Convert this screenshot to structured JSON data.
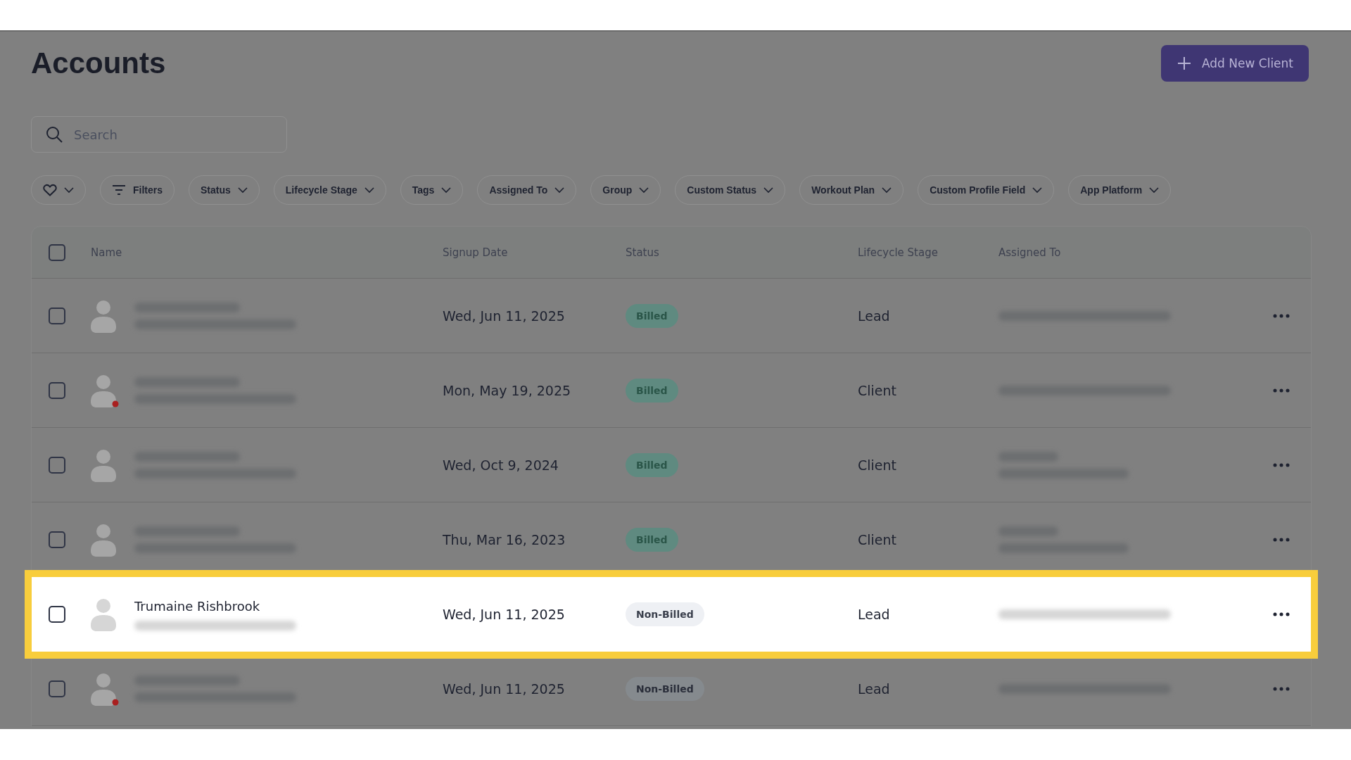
{
  "page": {
    "title": "Accounts"
  },
  "add_button": {
    "label": "Add New Client"
  },
  "search": {
    "placeholder": "Search"
  },
  "filters": [
    {
      "kind": "favorite"
    },
    {
      "kind": "filters",
      "label": "Filters"
    },
    {
      "kind": "dropdown",
      "label": "Status"
    },
    {
      "kind": "dropdown",
      "label": "Lifecycle Stage"
    },
    {
      "kind": "dropdown",
      "label": "Tags"
    },
    {
      "kind": "dropdown",
      "label": "Assigned To"
    },
    {
      "kind": "dropdown",
      "label": "Group"
    },
    {
      "kind": "dropdown",
      "label": "Custom Status"
    },
    {
      "kind": "dropdown",
      "label": "Workout Plan"
    },
    {
      "kind": "dropdown",
      "label": "Custom Profile Field"
    },
    {
      "kind": "dropdown",
      "label": "App Platform"
    }
  ],
  "table": {
    "columns": [
      "Name",
      "Signup Date",
      "Status",
      "Lifecycle Stage",
      "Assigned To"
    ],
    "all_checked": false,
    "rows": [
      {
        "checked": false,
        "alert_dot": false,
        "highlighted": false,
        "signup_date": "Wed, Jun 11, 2025",
        "status": "Billed",
        "billed": true,
        "lifecycle_stage": "Lead",
        "assigned_to": {
          "kind": "single"
        }
      },
      {
        "checked": false,
        "alert_dot": true,
        "highlighted": false,
        "signup_date": "Mon, May 19, 2025",
        "status": "Billed",
        "billed": true,
        "lifecycle_stage": "Client",
        "assigned_to": {
          "kind": "single"
        }
      },
      {
        "checked": false,
        "alert_dot": false,
        "highlighted": false,
        "signup_date": "Wed, Oct 9, 2024",
        "status": "Billed",
        "billed": true,
        "lifecycle_stage": "Client",
        "assigned_to": {
          "kind": "double"
        }
      },
      {
        "checked": false,
        "alert_dot": false,
        "highlighted": false,
        "signup_date": "Thu, Mar 16, 2023",
        "status": "Billed",
        "billed": true,
        "lifecycle_stage": "Client",
        "assigned_to": {
          "kind": "double"
        }
      },
      {
        "checked": false,
        "alert_dot": false,
        "highlighted": true,
        "name": "Trumaine Rishbrook",
        "signup_date": "Wed, Jun 11, 2025",
        "status": "Non-Billed",
        "billed": false,
        "lifecycle_stage": "Lead",
        "assigned_to": {
          "kind": "single"
        }
      },
      {
        "checked": false,
        "alert_dot": true,
        "highlighted": false,
        "signup_date": "Wed, Jun 11, 2025",
        "status": "Non-Billed",
        "billed": false,
        "lifecycle_stage": "Lead",
        "assigned_to": {
          "kind": "single"
        }
      }
    ]
  }
}
